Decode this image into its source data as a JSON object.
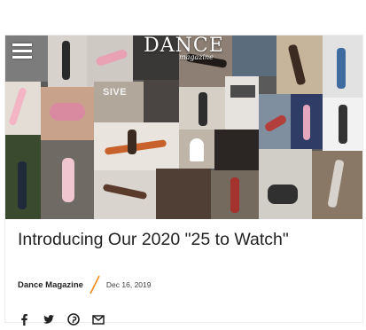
{
  "header": {
    "brand_name": "DANCE",
    "brand_sub": "magazine",
    "menu_icon": "hamburger-menu-icon"
  },
  "hero": {
    "poster_text": "SIVE"
  },
  "article": {
    "title": "Introducing Our 2020 \"25 to Watch\"",
    "author": "Dance Magazine",
    "date": "Dec 16, 2019",
    "accent_color": "#f28a1a"
  },
  "share": {
    "icons": [
      "facebook-icon",
      "twitter-icon",
      "pinterest-icon",
      "email-icon"
    ]
  }
}
